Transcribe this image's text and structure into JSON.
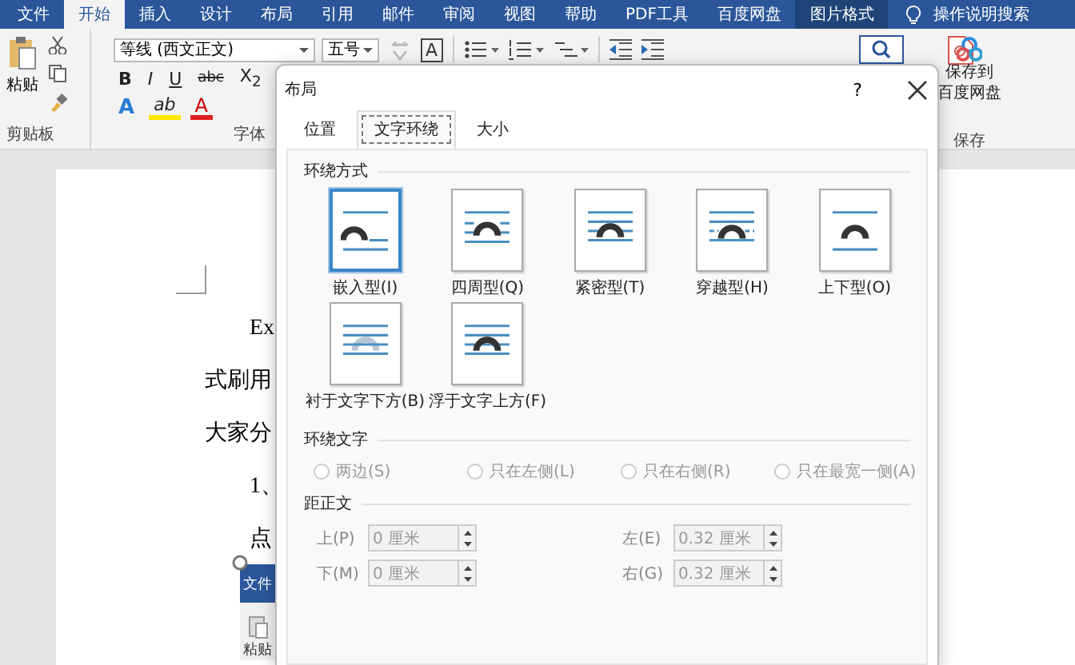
{
  "menu_tabs": [
    {
      "label": "文件",
      "selected": false,
      "contextual": false
    },
    {
      "label": "开始",
      "selected": true,
      "contextual": false
    },
    {
      "label": "插入",
      "selected": false,
      "contextual": false
    },
    {
      "label": "设计",
      "selected": false,
      "contextual": false
    },
    {
      "label": "布局",
      "selected": false,
      "contextual": false
    },
    {
      "label": "引用",
      "selected": false,
      "contextual": false
    },
    {
      "label": "邮件",
      "selected": false,
      "contextual": false
    },
    {
      "label": "审阅",
      "selected": false,
      "contextual": false
    },
    {
      "label": "视图",
      "selected": false,
      "contextual": false
    },
    {
      "label": "帮助",
      "selected": false,
      "contextual": false
    },
    {
      "label": "PDF工具",
      "selected": false,
      "contextual": false
    },
    {
      "label": "百度网盘",
      "selected": false,
      "contextual": false
    },
    {
      "label": "图片格式",
      "selected": false,
      "contextual": true
    }
  ],
  "tell_me": "操作说明搜索",
  "ribbon": {
    "clipboard": {
      "paste": "粘贴",
      "group": "剪贴板"
    },
    "font": {
      "name": "等线 (西文正文)",
      "size": "五号",
      "char_border": "A",
      "row_2": [
        "B",
        "I",
        "U",
        "abc",
        "X$_{2}$"
      ],
      "row_3": [
        "A",
        "ab",
        "A"
      ],
      "group": "字体"
    },
    "save": {
      "button": [
        "保存到",
        "百度网盘"
      ],
      "group": "保存"
    }
  },
  "document": {
    "lines": [
      {
        "text": "Ex",
        "indented": true
      },
      {
        "text": "式刷用",
        "indented": false
      },
      {
        "text": "大家分",
        "indented": false
      },
      {
        "text": "1、",
        "indented": true
      },
      {
        "text": "点",
        "indented": true
      }
    ],
    "inset": {
      "tab": "文件",
      "button": "粘贴"
    }
  },
  "dialog": {
    "title": "布局",
    "help": "?",
    "tabs": [
      {
        "label": "位置",
        "selected": false
      },
      {
        "label": "文字环绕",
        "selected": true
      },
      {
        "label": "大小",
        "selected": false
      }
    ],
    "wrap_section": "环绕方式",
    "wrap_options": [
      {
        "label": "嵌入型(I)",
        "kind": "inline",
        "selected": true
      },
      {
        "label": "四周型(Q)",
        "kind": "square",
        "selected": false
      },
      {
        "label": "紧密型(T)",
        "kind": "tight",
        "selected": false
      },
      {
        "label": "穿越型(H)",
        "kind": "through",
        "selected": false
      },
      {
        "label": "上下型(O)",
        "kind": "topbottom",
        "selected": false
      },
      {
        "label": "衬于文字下方(B)",
        "kind": "behind",
        "selected": false
      },
      {
        "label": "浮于文字上方(F)",
        "kind": "front",
        "selected": false
      }
    ],
    "text_section": "环绕文字",
    "text_options": [
      {
        "label": "两边(S)",
        "selected": false,
        "disabled": true
      },
      {
        "label": "只在左侧(L)",
        "selected": false,
        "disabled": true
      },
      {
        "label": "只在右侧(R)",
        "selected": false,
        "disabled": true
      },
      {
        "label": "只在最宽一侧(A)",
        "selected": false,
        "disabled": true
      }
    ],
    "distance_section": "距正文",
    "distances": [
      {
        "label": "上(P)",
        "value": "0 厘米",
        "disabled": true
      },
      {
        "label": "左(E)",
        "value": "0.32 厘米",
        "disabled": true
      },
      {
        "label": "下(M)",
        "value": "0 厘米",
        "disabled": true
      },
      {
        "label": "右(G)",
        "value": "0.32 厘米",
        "disabled": true
      }
    ]
  }
}
